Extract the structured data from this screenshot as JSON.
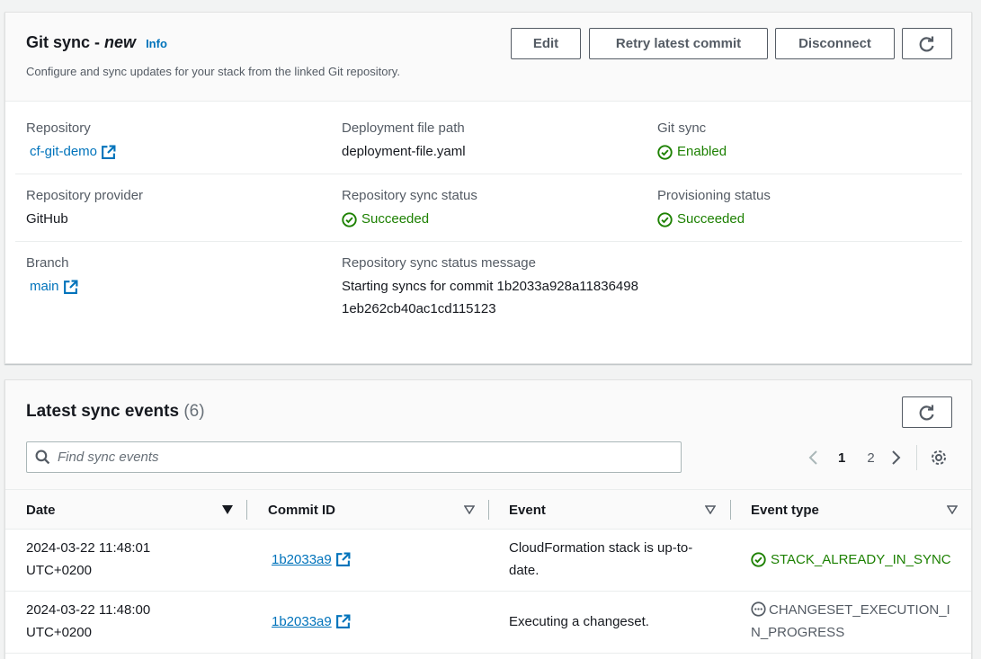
{
  "gitsync": {
    "title_prefix": "Git sync - ",
    "title_new": "new",
    "info_link": "Info",
    "description": "Configure and sync updates for your stack from the linked Git repository.",
    "buttons": {
      "edit": "Edit",
      "retry": "Retry latest commit",
      "disconnect": "Disconnect"
    },
    "fields": {
      "repository_label": "Repository",
      "repository_value": "cf-git-demo",
      "deployment_file_label": "Deployment file path",
      "deployment_file_value": "deployment-file.yaml",
      "git_sync_label": "Git sync",
      "git_sync_value": "Enabled",
      "provider_label": "Repository provider",
      "provider_value": "GitHub",
      "repo_sync_status_label": "Repository sync status",
      "repo_sync_status_value": "Succeeded",
      "provisioning_status_label": "Provisioning status",
      "provisioning_status_value": "Succeeded",
      "branch_label": "Branch",
      "branch_value": "main",
      "sync_message_label": "Repository sync status message",
      "sync_message_value": "Starting syncs for commit 1b2033a928a118364981eb262cb40ac1cd115123"
    }
  },
  "events": {
    "title": "Latest sync events",
    "count": "(6)",
    "search_placeholder": "Find sync events",
    "pagination": {
      "current": "1",
      "next_page": "2"
    },
    "columns": {
      "date": "Date",
      "commit": "Commit ID",
      "event": "Event",
      "type": "Event type"
    },
    "rows": [
      {
        "date": "2024-03-22 11:48:01 UTC+0200",
        "commit": "1b2033a9",
        "event": "CloudFormation stack is up-to-date.",
        "type": "STACK_ALREADY_IN_SYNC"
      },
      {
        "date": "2024-03-22 11:48:00 UTC+0200",
        "commit": "1b2033a9",
        "event": "Executing a changeset.",
        "type": "CHANGESET_EXECUTION_IN_PROGRESS"
      }
    ]
  },
  "colors": {
    "link": "#0073bb",
    "success": "#1d8102",
    "text": "#16191f",
    "secondary": "#545b64"
  }
}
